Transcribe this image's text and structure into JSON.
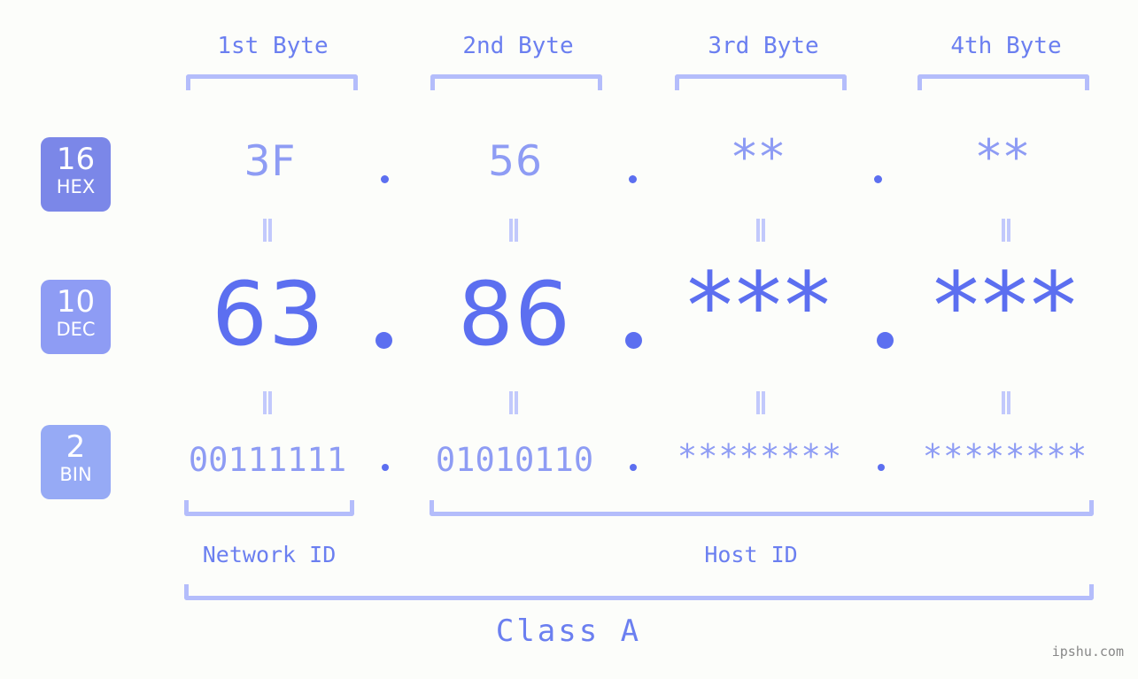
{
  "colors": {
    "background": "#fcfdfa",
    "accent_strong": "#5c6ff0",
    "accent_mid": "#6b7ff0",
    "accent_light": "#8e9cf4",
    "bracket": "#b4bdfb",
    "eqmark": "#c2c9fc",
    "badge_hex": "#7b87e8",
    "badge_dec": "#8e9cf4",
    "badge_bin": "#96aaf5",
    "watermark": "#888888"
  },
  "byte_headers": [
    {
      "label": "1st Byte"
    },
    {
      "label": "2nd Byte"
    },
    {
      "label": "3rd Byte"
    },
    {
      "label": "4th Byte"
    }
  ],
  "bases": [
    {
      "num": "16",
      "abbr": "HEX"
    },
    {
      "num": "10",
      "abbr": "DEC"
    },
    {
      "num": "2",
      "abbr": "BIN"
    }
  ],
  "rows": {
    "hex": {
      "base_num": "16",
      "base_abbr": "HEX",
      "values": [
        "3F",
        "56",
        "**",
        "**"
      ]
    },
    "dec": {
      "base_num": "10",
      "base_abbr": "DEC",
      "values": [
        "63",
        "86",
        "***",
        "***"
      ]
    },
    "bin": {
      "base_num": "2",
      "base_abbr": "BIN",
      "values": [
        "00111111",
        "01010110",
        "********",
        "********"
      ]
    }
  },
  "separators": {
    "dot": ".",
    "equality": "ǁ"
  },
  "sections": {
    "network_id": "Network ID",
    "host_id": "Host ID",
    "class": "Class A"
  },
  "watermark": "ipshu.com"
}
